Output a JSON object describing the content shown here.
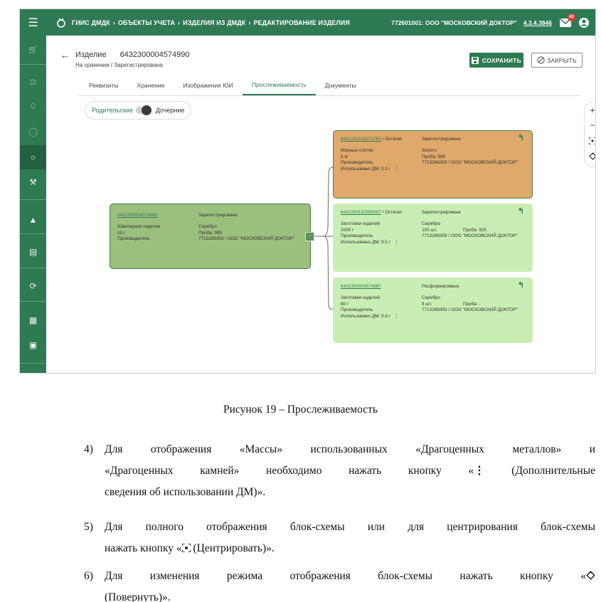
{
  "topbar": {
    "menu_icon": "menu-icon",
    "breadcrumbs": [
      "ГИИС ДМДК",
      "ОБЪЕКТЫ УЧЕТА",
      "ИЗДЕЛИЯ ИЗ ДМДК",
      "РЕДАКТИРОВАНИЕ ИЗДЕЛИЯ"
    ],
    "organization": "772601001: ООО \"МОСКОВСКИЙ ДОКТОР\"",
    "version": "4.3.4.3846",
    "mail_badge": "42",
    "accent_color": "#2e7a53"
  },
  "sidebar": {
    "items": [
      "cart-icon",
      "scales-icon",
      "diamond-icon",
      "circle-icon",
      "ring-icon",
      "tools-icon",
      "flask-icon",
      "clipboard-icon",
      "sync-icon",
      "badge-icon",
      "card-icon",
      "document-icon"
    ]
  },
  "header": {
    "label": "Изделие",
    "number": "6432300004574990",
    "status": "На хранении / Зарегистрирована",
    "save_label": "СОХРАНИТЬ",
    "close_label": "ЗАКРЫТЬ"
  },
  "tabs": [
    "Реквизиты",
    "Хранение",
    "Изображения ЮИ",
    "Прослеживаемость",
    "Документы"
  ],
  "active_tab": "Прослеживаемость",
  "toggle": {
    "left": "Родительские",
    "right": "Дочерние"
  },
  "zoom": {
    "plus": "+",
    "minus": "−"
  },
  "nodes": {
    "root": {
      "id": "6432300004574990",
      "status": "Зарегистрирована",
      "rows": [
        [
          "Ювелирное изделие",
          "Серебро"
        ],
        [
          "10 г",
          "Проба: 999"
        ],
        [
          "Производитель",
          "7713266359 / ООО \"МОСКОВСКИЙ ДОКТОР\""
        ]
      ]
    },
    "n1": {
      "id": "6432200192074763",
      "kind": " / Остатки",
      "status": "Зарегистрирована",
      "rows": [
        [
          "Мерные слитки",
          "Золото"
        ],
        [
          "5 кг",
          "Проба: 999"
        ],
        [
          "Производитель",
          "7713266359 / ООО \"МОСКОВСКИЙ ДОКТОР\""
        ]
      ],
      "used": "Использовано ДМ: 0.3 г"
    },
    "n2": {
      "id": "6432200192599397",
      "kind": " / Остатки",
      "status": "Зарегистрирована",
      "rows": [
        [
          "Заготовки изделий",
          "Серебро",
          ""
        ],
        [
          "1000 г",
          "100 шт.",
          "Проба: 925"
        ],
        [
          "Производитель",
          "7713266359 / ООО \"МОСКОВСКИЙ ДОКТОР\"",
          ""
        ]
      ],
      "used": "Использовано ДМ: 9.5 г"
    },
    "n3": {
      "id": "6432300004574987",
      "kind": "",
      "status": "Расформирована",
      "rows": [
        [
          "Заготовки изделий",
          "Серебро",
          ""
        ],
        [
          "80 г",
          "8 шт.",
          "Проба: -"
        ],
        [
          "Производитель",
          "7713266359 / ООО \"МОСКОВСКИЙ ДОКТОР\"",
          ""
        ]
      ],
      "used": "Использовано ДМ: 9.8 г"
    },
    "colors": {
      "root": "#9bc07e",
      "parent": "#dea96a",
      "child": "#c9eeb3"
    }
  },
  "document": {
    "caption": "Рисунок 19 – Прослеживаемость",
    "items": [
      {
        "num": "4)",
        "lines": [
          "Для отображения «Массы» использованных «Драгоценных металлов» и",
          "«Драгоценных камней» необходимо нажать кнопку «",
          " (Дополнительные",
          "сведения об использовании ДМ)»."
        ]
      },
      {
        "num": "5)",
        "lines": [
          "Для полного отображения блок-схемы или для центрирования блок-схемы",
          "нажать кнопку «",
          " (Центрировать)»."
        ]
      },
      {
        "num": "6)",
        "lines": [
          "Для изменения режима отображения блок-схемы нажать кнопку «",
          "(Повернуть)»."
        ]
      }
    ]
  }
}
